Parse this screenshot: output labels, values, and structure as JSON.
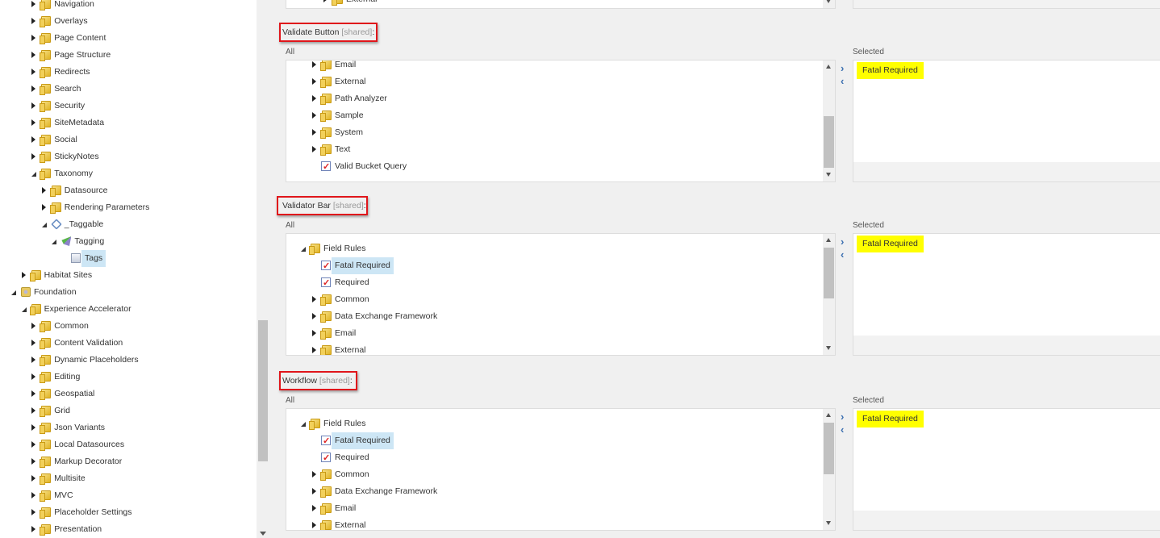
{
  "left_tree": [
    {
      "label": "Navigation",
      "level": 3,
      "state": "collapsed",
      "icon": "folder"
    },
    {
      "label": "Overlays",
      "level": 3,
      "state": "collapsed",
      "icon": "folder"
    },
    {
      "label": "Page Content",
      "level": 3,
      "state": "collapsed",
      "icon": "folder"
    },
    {
      "label": "Page Structure",
      "level": 3,
      "state": "collapsed",
      "icon": "folder"
    },
    {
      "label": "Redirects",
      "level": 3,
      "state": "collapsed",
      "icon": "folder"
    },
    {
      "label": "Search",
      "level": 3,
      "state": "collapsed",
      "icon": "folder"
    },
    {
      "label": "Security",
      "level": 3,
      "state": "collapsed",
      "icon": "folder"
    },
    {
      "label": "SiteMetadata",
      "level": 3,
      "state": "collapsed",
      "icon": "folder"
    },
    {
      "label": "Social",
      "level": 3,
      "state": "collapsed",
      "icon": "folder"
    },
    {
      "label": "StickyNotes",
      "level": 3,
      "state": "collapsed",
      "icon": "folder"
    },
    {
      "label": "Taxonomy",
      "level": 3,
      "state": "expanded",
      "icon": "folder"
    },
    {
      "label": "Datasource",
      "level": 4,
      "state": "collapsed",
      "icon": "folder"
    },
    {
      "label": "Rendering Parameters",
      "level": 4,
      "state": "collapsed",
      "icon": "folder"
    },
    {
      "label": "_Taggable",
      "level": 4,
      "state": "expanded",
      "icon": "tag"
    },
    {
      "label": "Tagging",
      "level": 5,
      "state": "expanded",
      "icon": "tmpl"
    },
    {
      "label": "Tags",
      "level": 6,
      "state": "leaf",
      "icon": "doc",
      "selected": true
    },
    {
      "label": "Habitat Sites",
      "level": 2,
      "state": "collapsed",
      "icon": "folder"
    },
    {
      "label": "Foundation",
      "level": 1,
      "state": "expanded",
      "icon": "module"
    },
    {
      "label": "Experience Accelerator",
      "level": 2,
      "state": "expanded",
      "icon": "folder"
    },
    {
      "label": "Common",
      "level": 3,
      "state": "collapsed",
      "icon": "folder"
    },
    {
      "label": "Content Validation",
      "level": 3,
      "state": "collapsed",
      "icon": "folder"
    },
    {
      "label": "Dynamic Placeholders",
      "level": 3,
      "state": "collapsed",
      "icon": "folder"
    },
    {
      "label": "Editing",
      "level": 3,
      "state": "collapsed",
      "icon": "folder"
    },
    {
      "label": "Geospatial",
      "level": 3,
      "state": "collapsed",
      "icon": "folder"
    },
    {
      "label": "Grid",
      "level": 3,
      "state": "collapsed",
      "icon": "folder"
    },
    {
      "label": "Json Variants",
      "level": 3,
      "state": "collapsed",
      "icon": "folder"
    },
    {
      "label": "Local Datasources",
      "level": 3,
      "state": "collapsed",
      "icon": "folder"
    },
    {
      "label": "Markup Decorator",
      "level": 3,
      "state": "collapsed",
      "icon": "folder"
    },
    {
      "label": "Multisite",
      "level": 3,
      "state": "collapsed",
      "icon": "folder"
    },
    {
      "label": "MVC",
      "level": 3,
      "state": "collapsed",
      "icon": "folder"
    },
    {
      "label": "Placeholder Settings",
      "level": 3,
      "state": "collapsed",
      "icon": "folder"
    },
    {
      "label": "Presentation",
      "level": 3,
      "state": "collapsed",
      "icon": "folder"
    }
  ],
  "top_partial": {
    "items": [
      {
        "label": "External",
        "level": 2,
        "state": "collapsed",
        "icon": "folder"
      }
    ]
  },
  "common": {
    "all_label": "All",
    "selected_label": "Selected",
    "shared_tag": "[shared]",
    "colon": ":"
  },
  "sections": [
    {
      "title": "Validate Button",
      "items": [
        {
          "label": "Email",
          "level": 2,
          "state": "collapsed",
          "icon": "folder"
        },
        {
          "label": "External",
          "level": 2,
          "state": "collapsed",
          "icon": "folder"
        },
        {
          "label": "Path Analyzer",
          "level": 2,
          "state": "collapsed",
          "icon": "folder"
        },
        {
          "label": "Sample",
          "level": 2,
          "state": "collapsed",
          "icon": "folder"
        },
        {
          "label": "System",
          "level": 2,
          "state": "collapsed",
          "icon": "folder"
        },
        {
          "label": "Text",
          "level": 2,
          "state": "collapsed",
          "icon": "folder"
        },
        {
          "label": "Valid Bucket Query",
          "level": 2,
          "state": "leaf",
          "icon": "valid"
        }
      ],
      "selected": [
        "Fatal Required"
      ]
    },
    {
      "title": "Validator Bar",
      "items": [
        {
          "label": "Field Rules",
          "level": 1,
          "state": "expanded",
          "icon": "folder"
        },
        {
          "label": "Fatal Required",
          "level": 2,
          "state": "leaf",
          "icon": "valid",
          "selected": true
        },
        {
          "label": "Required",
          "level": 2,
          "state": "leaf",
          "icon": "valid"
        },
        {
          "label": "Common",
          "level": 2,
          "state": "collapsed",
          "icon": "folder"
        },
        {
          "label": "Data Exchange Framework",
          "level": 2,
          "state": "collapsed",
          "icon": "folder"
        },
        {
          "label": "Email",
          "level": 2,
          "state": "collapsed",
          "icon": "folder"
        },
        {
          "label": "External",
          "level": 2,
          "state": "collapsed",
          "icon": "folder"
        }
      ],
      "selected": [
        "Fatal Required"
      ]
    },
    {
      "title": "Workflow",
      "items": [
        {
          "label": "Field Rules",
          "level": 1,
          "state": "expanded",
          "icon": "folder"
        },
        {
          "label": "Fatal Required",
          "level": 2,
          "state": "leaf",
          "icon": "valid",
          "selected": true
        },
        {
          "label": "Required",
          "level": 2,
          "state": "leaf",
          "icon": "valid"
        },
        {
          "label": "Common",
          "level": 2,
          "state": "collapsed",
          "icon": "folder"
        },
        {
          "label": "Data Exchange Framework",
          "level": 2,
          "state": "collapsed",
          "icon": "folder"
        },
        {
          "label": "Email",
          "level": 2,
          "state": "collapsed",
          "icon": "folder"
        },
        {
          "label": "External",
          "level": 2,
          "state": "collapsed",
          "icon": "folder"
        }
      ],
      "selected": [
        "Fatal Required"
      ]
    }
  ],
  "colors": {
    "highlight": "#ffff00",
    "selection": "#cde6f5",
    "annotation_border": "#e0161b",
    "arrow": "#3b6fb0"
  }
}
